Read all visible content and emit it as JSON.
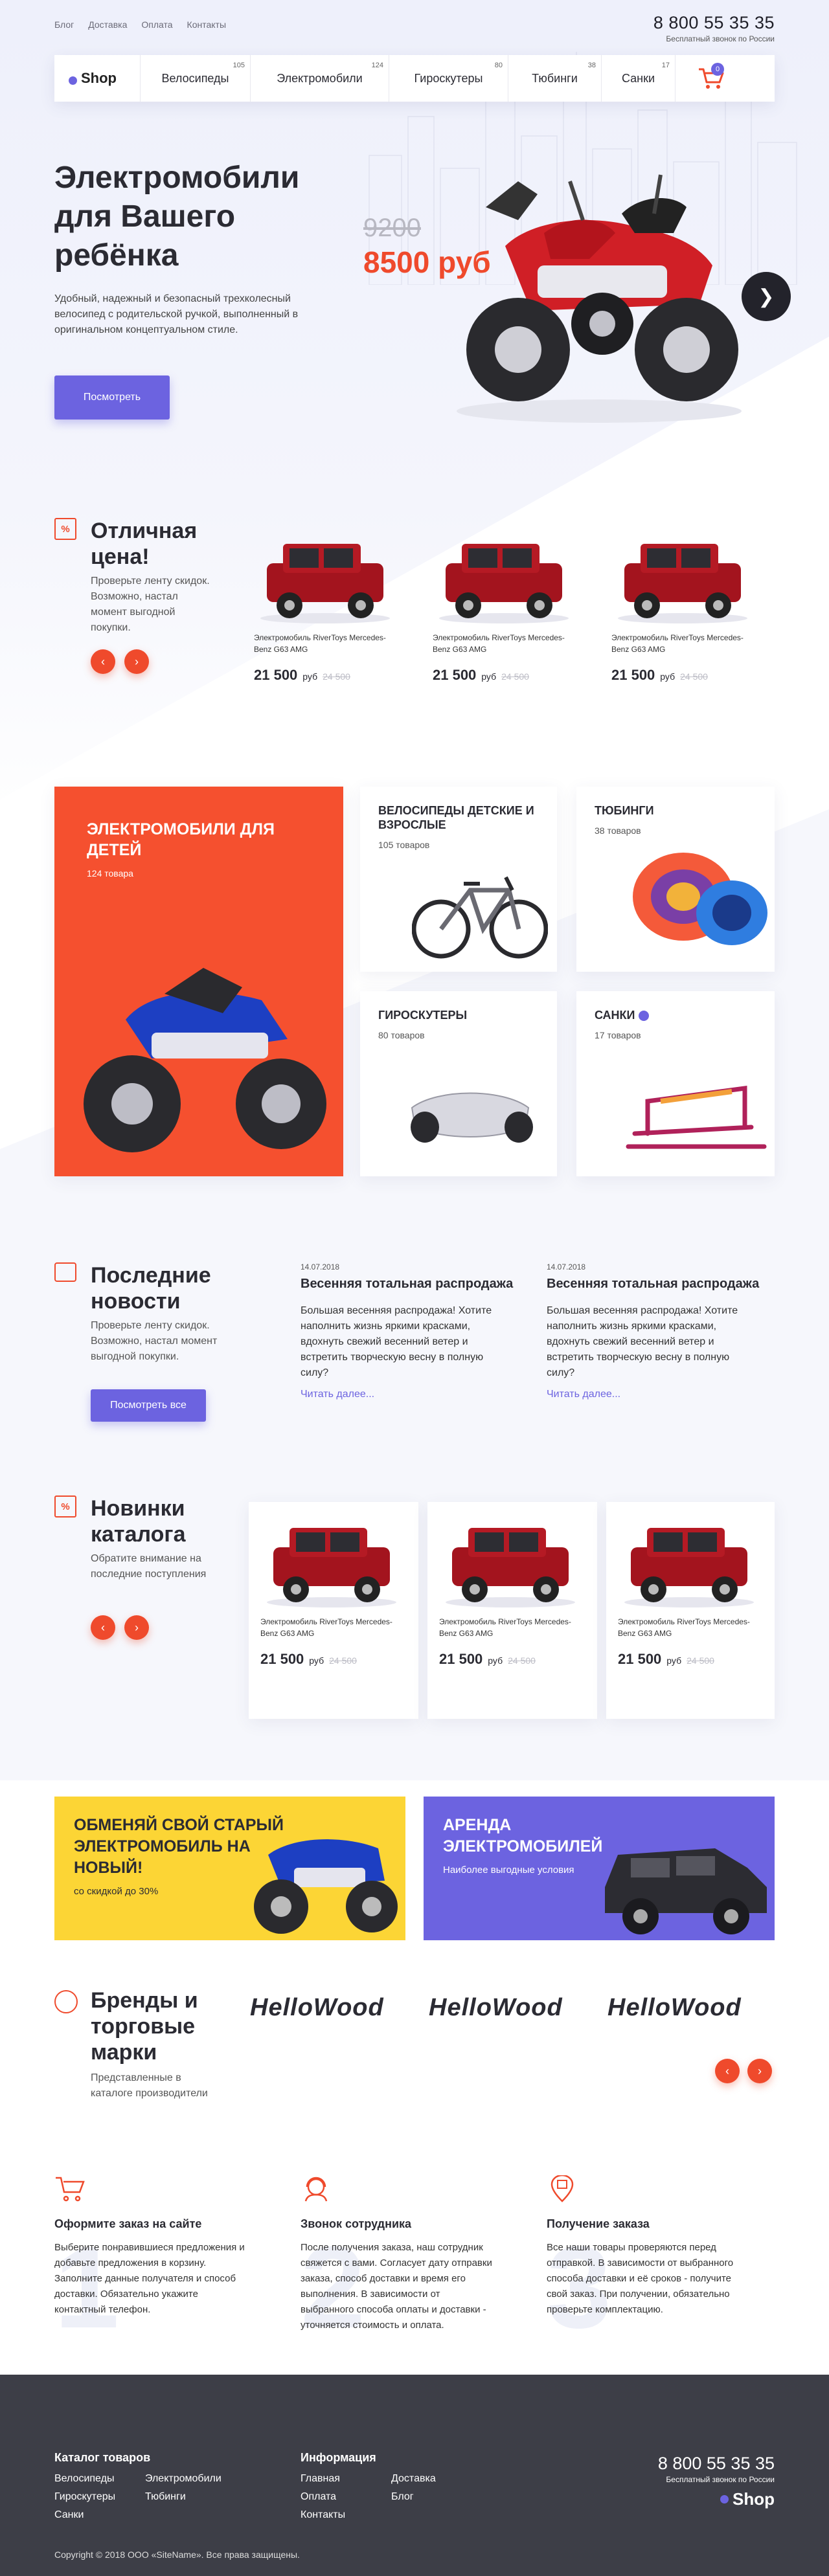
{
  "topnav": [
    "Блог",
    "Доставка",
    "Оплата",
    "Контакты"
  ],
  "phone": {
    "number": "8 800 55 35 35",
    "note": "Бесплатный звонок по России"
  },
  "logo": "Shop",
  "menu": [
    {
      "label": "Велосипеды",
      "count": "105"
    },
    {
      "label": "Электромобили",
      "count": "124"
    },
    {
      "label": "Гироскутеры",
      "count": "80"
    },
    {
      "label": "Тюбинги",
      "count": "38"
    },
    {
      "label": "Санки",
      "count": "17"
    }
  ],
  "cart_count": "0",
  "hero": {
    "title": "Электромобили для Вашего ребёнка",
    "desc": "Удобный, надежный и безопасный трехколесный велосипед с родительской ручкой, выполненный в оригинальном концептуальном стиле.",
    "button": "Посмотреть",
    "old_price": "9200",
    "new_price": "8500 руб"
  },
  "best_price": {
    "title": "Отличная цена!",
    "desc": "Проверьте ленту скидок. Возможно, настал момент выгодной покупки.",
    "icon": "%",
    "products": [
      {
        "name": "Электромобиль RiverToys Mercedes-Benz G63 AMG",
        "price": "21 500",
        "currency": "руб",
        "old": "24 500"
      },
      {
        "name": "Электромобиль RiverToys Mercedes-Benz G63 AMG",
        "price": "21 500",
        "currency": "руб",
        "old": "24 500"
      },
      {
        "name": "Электромобиль RiverToys Mercedes-Benz G63 AMG",
        "price": "21 500",
        "currency": "руб",
        "old": "24 500"
      }
    ]
  },
  "categories": {
    "main": {
      "title": "ЭЛЕКТРОМОБИЛИ ДЛЯ ДЕТЕЙ",
      "count": "124 товара"
    },
    "items": [
      {
        "title": "ВЕЛОСИПЕДЫ ДЕТСКИЕ И ВЗРОСЛЫЕ",
        "count": "105 товаров"
      },
      {
        "title": "ТЮБИНГИ",
        "count": "38 товаров"
      },
      {
        "title": "ГИРОСКУТЕРЫ",
        "count": "80 товаров"
      },
      {
        "title": "САНКИ",
        "count": "17 товаров"
      }
    ]
  },
  "news": {
    "title": "Последние новости",
    "desc": "Проверьте ленту скидок. Возможно, настал момент выгодной покупки.",
    "button": "Посмотреть все",
    "items": [
      {
        "date": "14.07.2018",
        "title": "Весенняя тотальная распродажа",
        "text": "Большая весенняя распродажа! Хотите наполнить жизнь яркими красками, вдохнуть свежий весенний ветер и встретить творческую весну в полную силу?",
        "link": "Читать далее..."
      },
      {
        "date": "14.07.2018",
        "title": "Весенняя тотальная распродажа",
        "text": "Большая весенняя распродажа! Хотите наполнить жизнь яркими красками, вдохнуть свежий весенний ветер и встретить творческую весну в полную силу?",
        "link": "Читать далее..."
      }
    ]
  },
  "new_items": {
    "title": "Новинки каталога",
    "desc": "Обратите внимание на последние поступления",
    "icon": "%",
    "products": [
      {
        "name": "Электромобиль RiverToys Mercedes-Benz G63 AMG",
        "price": "21 500",
        "currency": "руб",
        "old": "24 500"
      },
      {
        "name": "Электромобиль RiverToys Mercedes-Benz G63 AMG",
        "price": "21 500",
        "currency": "руб",
        "old": "24 500"
      },
      {
        "name": "Электромобиль RiverToys Mercedes-Benz G63 AMG",
        "price": "21 500",
        "currency": "руб",
        "old": "24 500"
      }
    ]
  },
  "banners": [
    {
      "title": "ОБМЕНЯЙ СВОЙ СТАРЫЙ ЭЛЕКТРОМОБИЛЬ НА НОВЫЙ!",
      "sub": "со скидкой до 30%"
    },
    {
      "title": "АРЕНДА ЭЛЕКТРОМОБИЛЕЙ",
      "sub": "Наиболее выгодные условия"
    }
  ],
  "brands": {
    "title": "Бренды и торговые марки",
    "desc": "Представленные в каталоге производители",
    "logos": [
      "HelloWood",
      "HelloWood",
      "HelloWood"
    ]
  },
  "steps": [
    {
      "num": "1",
      "title": "Оформите заказ на сайте",
      "text": "Выберите понравившиеся предложения и добавьте предложения в корзину. Заполните данные получателя и способ доставки. Обязательно укажите контактный телефон."
    },
    {
      "num": "2",
      "title": "Звонок сотрудника",
      "text": "После получения заказа, наш сотрудник свяжется с вами. Согласует дату отправки заказа, способ доставки и время его выполнения. В зависимости от выбранного способа оплаты и доставки - уточняется стоимость и оплата."
    },
    {
      "num": "3",
      "title": "Получение заказа",
      "text": "Все наши товары проверяются перед отправкой. В зависимости от выбранного способа доставки и её сроков - получите свой заказ. При получении, обязательно проверьте комплектацию."
    }
  ],
  "footer": {
    "catalog_title": "Каталог товаров",
    "catalog": [
      "Велосипеды",
      "Электромобили",
      "Гироскутеры",
      "Тюбинги",
      "Санки"
    ],
    "info_title": "Информация",
    "info": [
      "Главная",
      "Доставка",
      "Оплата",
      "Блог",
      "Контакты"
    ],
    "copyright": "Copyright © 2018 ООО «SiteName». Все права защищены."
  },
  "colors": {
    "accent": "#6c63e0",
    "red": "#ef4a2c",
    "yellow": "#fcd535",
    "footer": "#3d3e47"
  }
}
